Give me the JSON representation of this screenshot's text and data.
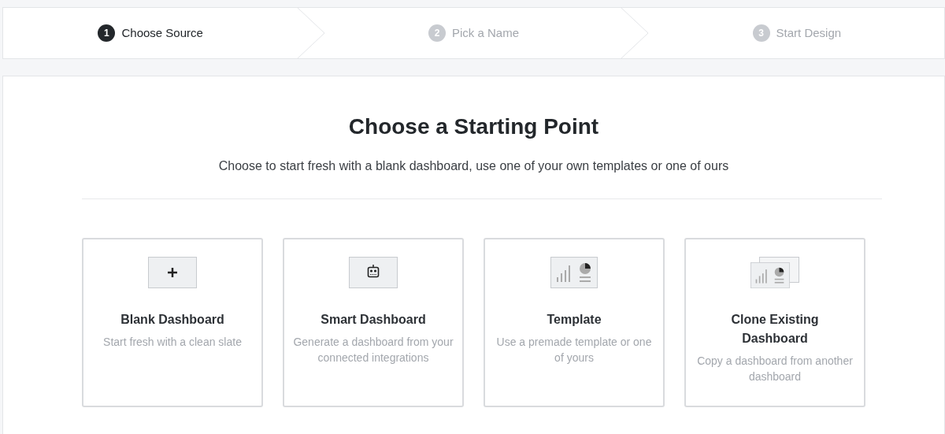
{
  "steps": [
    {
      "number": "1",
      "label": "Choose Source",
      "selected": true
    },
    {
      "number": "2",
      "label": "Pick a Name",
      "selected": false
    },
    {
      "number": "3",
      "label": "Start Design",
      "selected": false
    }
  ],
  "heading": "Choose a Starting Point",
  "subheading": "Choose to start fresh with a blank dashboard, use one of your own templates or one of ours",
  "options": [
    {
      "kind": "blank",
      "title": "Blank Dashboard",
      "description": "Start fresh with a clean slate"
    },
    {
      "kind": "smart",
      "title": "Smart Dashboard",
      "description": "Generate a dashboard from your connected integrations"
    },
    {
      "kind": "template",
      "title": "Template",
      "description": "Use a premade template or one of yours"
    },
    {
      "kind": "clone",
      "title": "Clone Existing Dashboard",
      "description": "Copy a dashboard from another dashboard"
    }
  ]
}
